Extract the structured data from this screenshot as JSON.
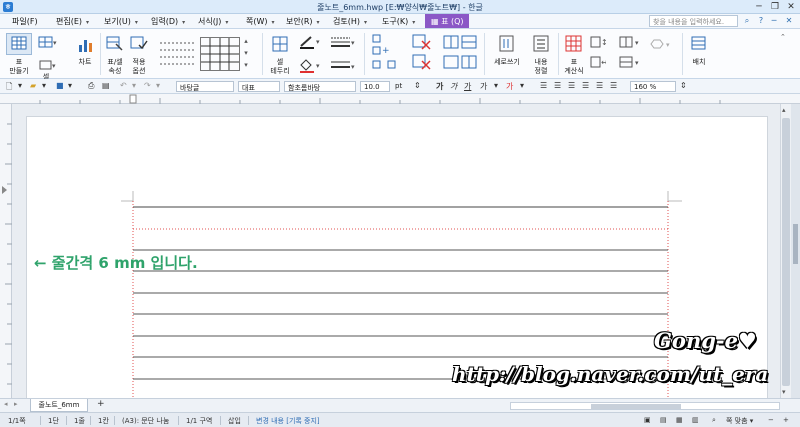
{
  "window": {
    "title": "줄노트_6mm.hwp [E:₩양식₩줄노트₩] - 한글",
    "minimize": "─",
    "restore": "❐",
    "close": "✕"
  },
  "menu": {
    "items": [
      "파일(F)",
      "편집(E)",
      "보기(U)",
      "입력(D)",
      "서식(J)",
      "쪽(W)",
      "보안(R)",
      "검토(H)",
      "도구(K)"
    ],
    "active_tab": "표 (Q)",
    "search_placeholder": "찾을 내용을 입력하세요."
  },
  "ribbon": {
    "table_create": "표\n만들기",
    "table_create_l1": "표",
    "table_create_l2": "만들기",
    "cell_label": "셀",
    "chart": "차트",
    "table_props_l1": "표/셀",
    "table_props_l2": "속성",
    "apply_l1": "적용",
    "apply_l2": "옵션",
    "cell_border_l1": "셀",
    "cell_border_l2": "테두리",
    "vertical_write": "세로쓰기",
    "content_align_l1": "내용",
    "content_align_l2": "정렬",
    "table_calc_l1": "표",
    "table_calc_l2": "계산식",
    "arrange": "배치"
  },
  "format": {
    "style": "바탕글",
    "lang": "대표",
    "font": "함초롬바탕",
    "size": "10.0",
    "unit": "pt",
    "zoom": "160",
    "zoom_unit": "%",
    "bold": "가",
    "italic": "가",
    "underline": "가"
  },
  "document": {
    "annotation": "← 줄간격 6 mm 입니다."
  },
  "tabs": {
    "doc_tab": "줄노트_6mm",
    "add_tab": "+"
  },
  "status": {
    "page": "1/1쪽",
    "section": "1단",
    "line": "1줄",
    "column": "1칸",
    "paper": "(A3): 문단 나눔",
    "zone": "1/1 구역",
    "insert": "삽입",
    "track": "변경 내용 [기록 중지]",
    "zoom_fit": "쪽 맞춤"
  },
  "watermark": {
    "signature": "Gong-e♥",
    "url": "http://blog.naver.com/ut_era"
  },
  "colors": {
    "accent_purple": "#8b58c6",
    "annotation_green": "#2fa36b",
    "guide_red": "#e05050"
  }
}
